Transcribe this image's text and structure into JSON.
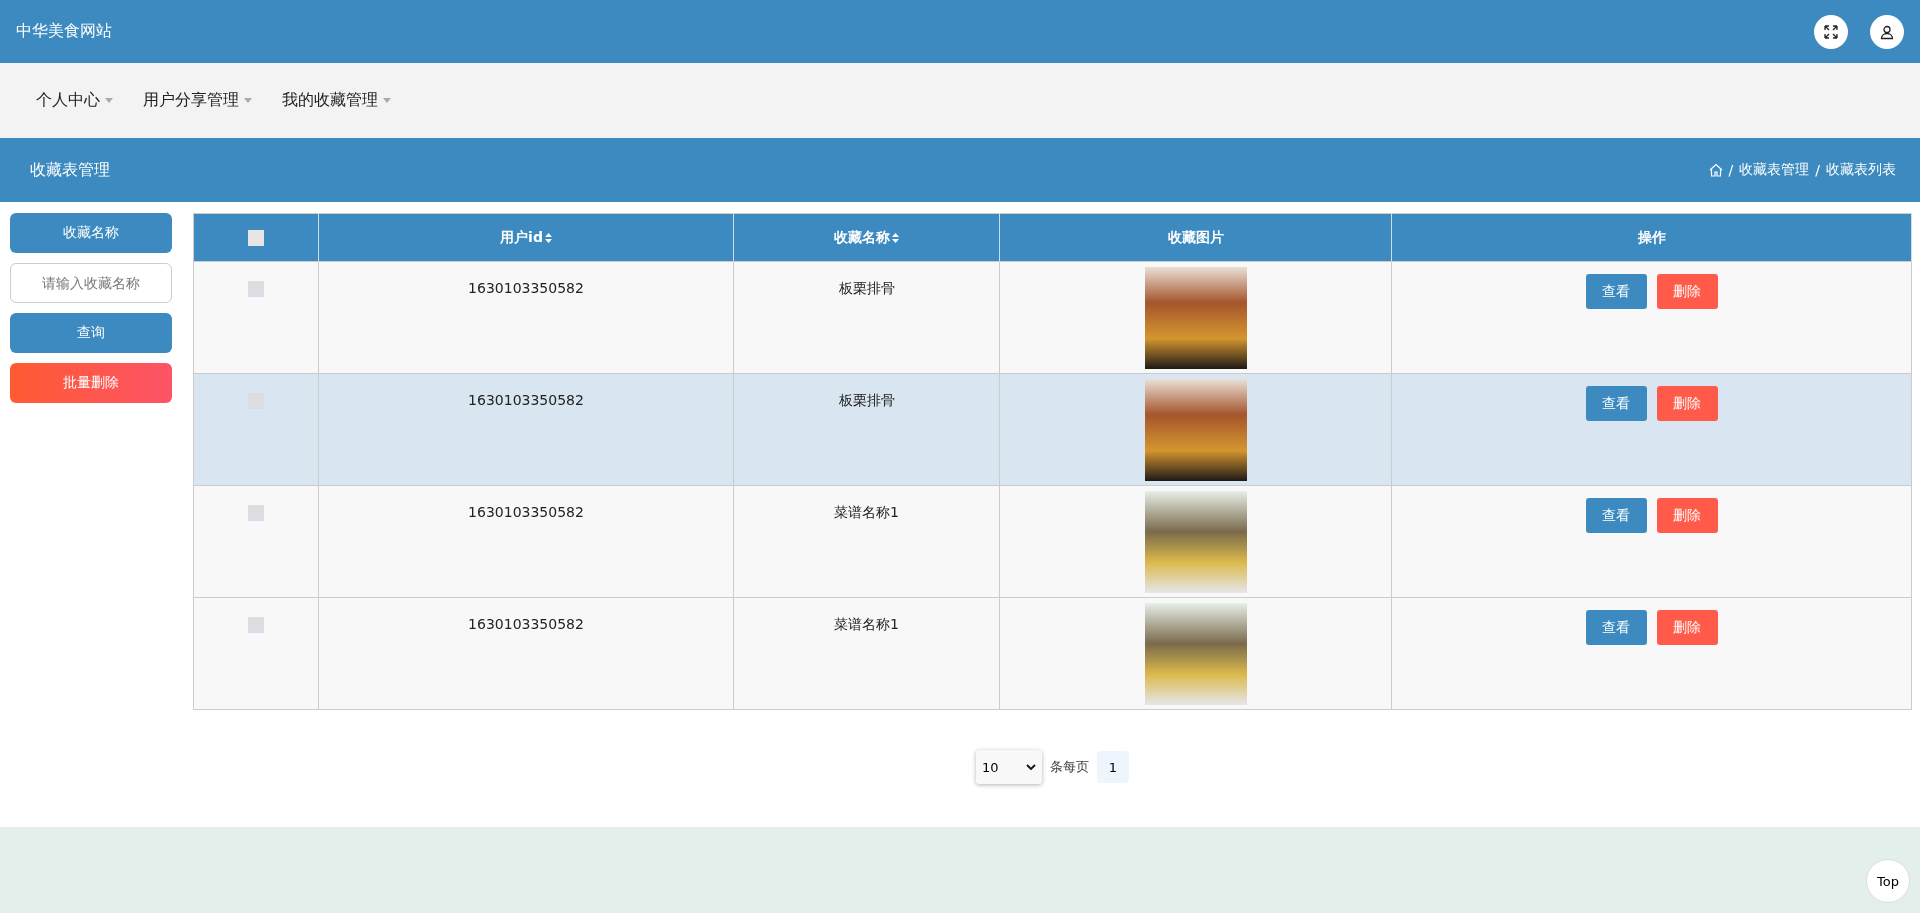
{
  "header": {
    "site_title": "中华美食网站"
  },
  "nav": {
    "items": [
      {
        "label": "个人中心"
      },
      {
        "label": "用户分享管理"
      },
      {
        "label": "我的收藏管理"
      }
    ]
  },
  "page_bar": {
    "title": "收藏表管理",
    "breadcrumb": [
      {
        "separator": "/",
        "label": "收藏表管理"
      },
      {
        "separator": "/",
        "label": "收藏表列表"
      }
    ]
  },
  "sidebar": {
    "search_label": "收藏名称",
    "search_placeholder": "请输入收藏名称",
    "query_button": "查询",
    "batch_delete_button": "批量删除"
  },
  "table": {
    "header_checked": false,
    "columns": [
      "用户id",
      "收藏名称",
      "收藏图片",
      "操作"
    ],
    "rows": [
      {
        "checked": false,
        "highlighted": false,
        "user_id": "1630103350582",
        "name": "板栗排骨",
        "view": "查看",
        "delete": "删除"
      },
      {
        "checked": false,
        "highlighted": true,
        "user_id": "1630103350582",
        "name": "板栗排骨",
        "view": "查看",
        "delete": "删除"
      },
      {
        "checked": false,
        "highlighted": false,
        "user_id": "1630103350582",
        "name": "菜谱名称1",
        "view": "查看",
        "delete": "删除"
      },
      {
        "checked": false,
        "highlighted": false,
        "user_id": "1630103350582",
        "name": "菜谱名称1",
        "view": "查看",
        "delete": "删除"
      }
    ]
  },
  "pagination": {
    "page_size": "10",
    "per_page_label": "条每页",
    "pages": [
      {
        "label": "1",
        "selected": true
      }
    ]
  },
  "top_button": "Top"
}
